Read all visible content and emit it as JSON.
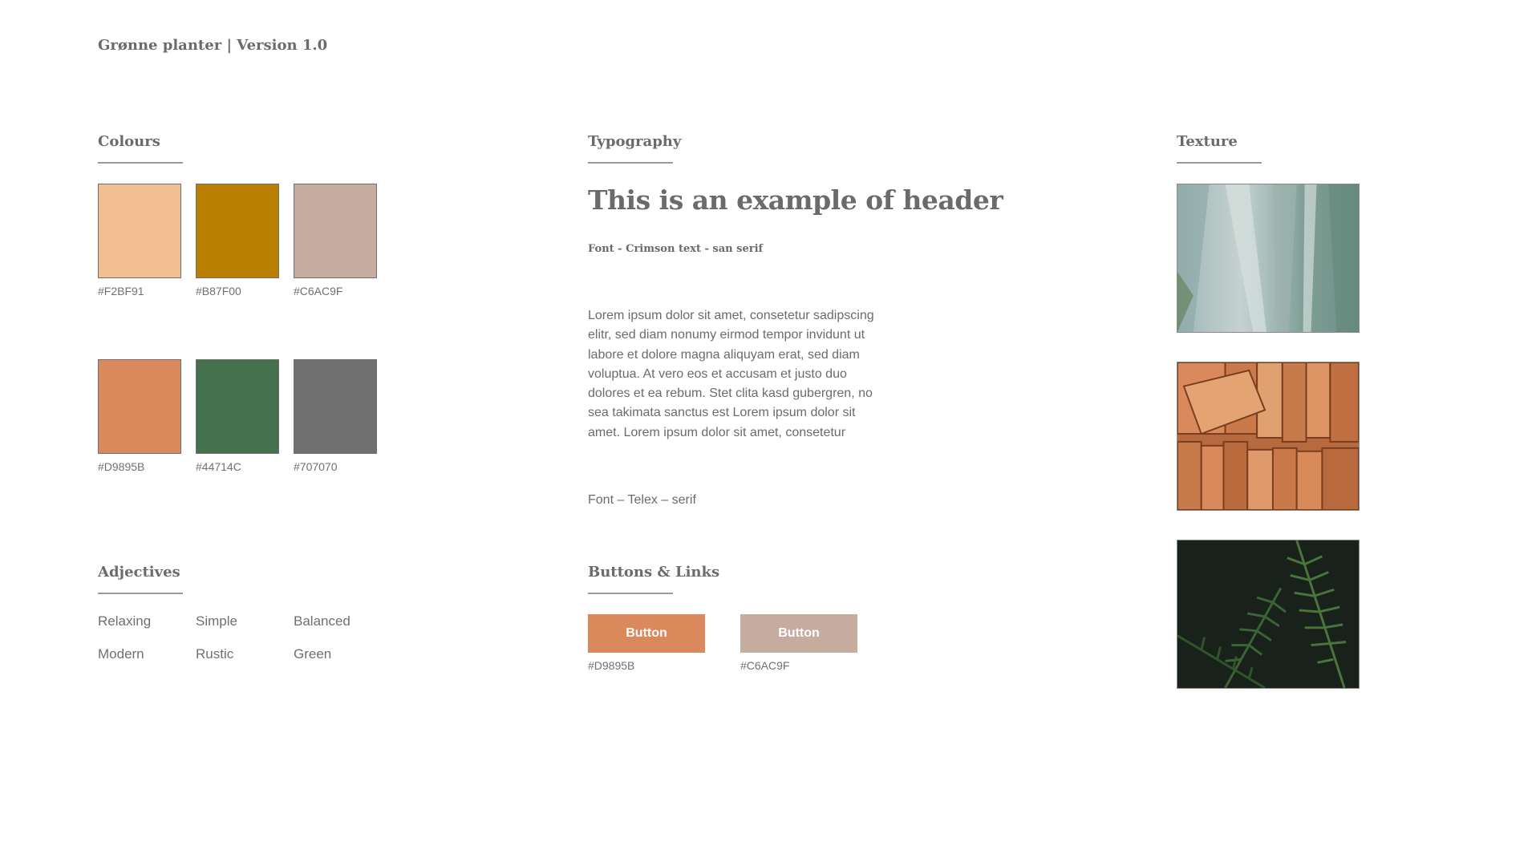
{
  "document": {
    "title": "Grønne planter | Version 1.0"
  },
  "colours": {
    "title": "Colours",
    "swatches": [
      {
        "hex": "#F2BF91",
        "label": "#F2BF91"
      },
      {
        "hex": "#B87F00",
        "label": "#B87F00"
      },
      {
        "hex": "#C6AC9F",
        "label": "#C6AC9F"
      },
      {
        "hex": "#D9895B",
        "label": "#D9895B"
      },
      {
        "hex": "#44714C",
        "label": "#44714C"
      },
      {
        "hex": "#707070",
        "label": "#707070"
      }
    ]
  },
  "adjectives": {
    "title": "Adjectives",
    "items": [
      "Relaxing",
      "Simple",
      "Balanced",
      "Modern",
      "Rustic",
      "Green"
    ]
  },
  "typography": {
    "title": "Typography",
    "header_example": "This is an example of header",
    "header_font_note": "Font - Crimson text - san serif",
    "body_example": "Lorem ipsum dolor sit amet, consetetur sadipscing elitr, sed diam nonumy eirmod tempor invidunt ut labore et dolore magna aliquyam erat, sed diam voluptua. At vero eos et accusam et justo duo dolores et ea rebum. Stet clita kasd gubergren, no sea takimata sanctus est Lorem ipsum dolor sit amet. Lorem ipsum dolor sit amet, consetetur",
    "body_font_note": "Font – Telex – serif"
  },
  "buttons": {
    "title": "Buttons & Links",
    "items": [
      {
        "label": "Button",
        "color": "#D9895B",
        "hex_label": "#D9895B"
      },
      {
        "label": "Button",
        "color": "#C6AC9F",
        "hex_label": "#C6AC9F"
      }
    ]
  },
  "texture": {
    "title": "Texture",
    "images": [
      {
        "icon": "agave-leaf-texture"
      },
      {
        "icon": "brick-stack-texture"
      },
      {
        "icon": "fern-leaves-texture"
      }
    ]
  },
  "theme": {
    "text": "#707070",
    "rule": "#9a9a9a",
    "background": "#FFFFFF"
  }
}
